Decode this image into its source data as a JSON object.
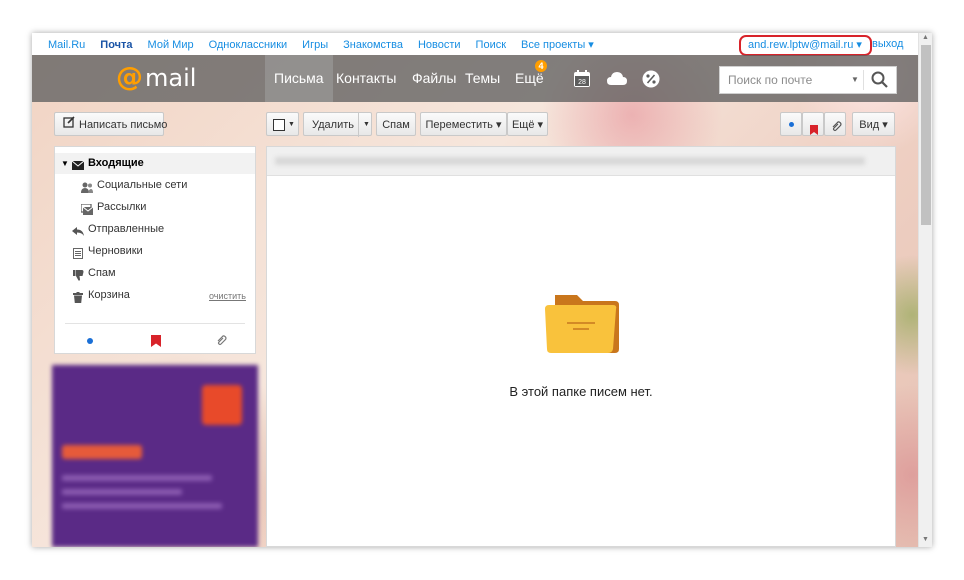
{
  "portal": {
    "links": [
      "Mail.Ru",
      "Почта",
      "Мой Мир",
      "Одноклассники",
      "Игры",
      "Знакомства",
      "Новости",
      "Поиск",
      "Все проекты ▾"
    ],
    "user_email": "and.rew.lptw@mail.ru ▾",
    "logout": "выход"
  },
  "header": {
    "logo_at": "@",
    "logo_word": "mail",
    "tabs": [
      "Письма",
      "Контакты",
      "Файлы",
      "Темы",
      "Ещё"
    ],
    "more_badge": "4",
    "calendar_day": "28",
    "search_placeholder": "Поиск по почте"
  },
  "toolbar": {
    "compose": "Написать письмо",
    "delete": "Удалить",
    "spam": "Спам",
    "move": "Переместить ▾",
    "more": "Ещё ▾",
    "view": "Вид ▾"
  },
  "folders": [
    {
      "name": "Входящие",
      "icon": "envelope-icon",
      "selected": true
    },
    {
      "name": "Социальные сети",
      "icon": "people-icon",
      "selected": false
    },
    {
      "name": "Рассылки",
      "icon": "newsletter-icon",
      "selected": false
    },
    {
      "name": "Отправленные",
      "icon": "reply-arrow-icon",
      "selected": false
    },
    {
      "name": "Черновики",
      "icon": "document-icon",
      "selected": false
    },
    {
      "name": "Спам",
      "icon": "thumbs-down-icon",
      "selected": false
    },
    {
      "name": "Корзина",
      "icon": "trash-icon",
      "selected": false
    }
  ],
  "clear_label": "очистить",
  "empty_message": "В этой папке писем нет.",
  "colors": {
    "accent": "#ff9e00",
    "link": "#168de2",
    "highlight": "#d8232a",
    "flag": "#d8232a",
    "unread_dot": "#1a6fd6"
  }
}
